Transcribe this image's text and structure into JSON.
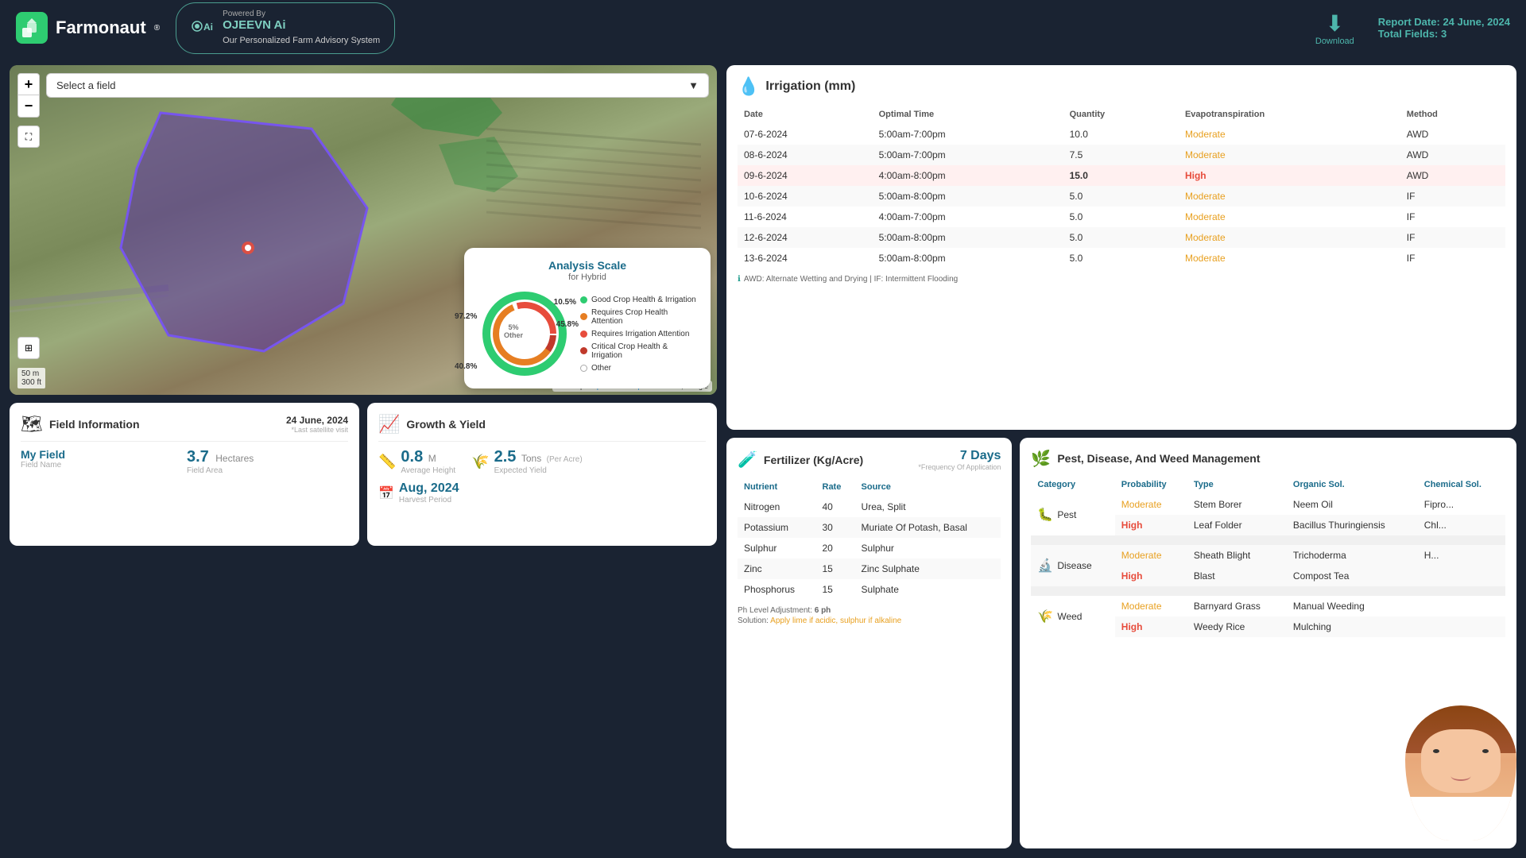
{
  "header": {
    "logo_text": "Farmonaut",
    "logo_reg": "®",
    "jeevn_label": "OJEEVN Ai",
    "jeevn_powered": "Powered By",
    "jeevn_sub": "Our Personalized Farm Advisory System",
    "download_label": "Download",
    "report_date_label": "Report Date:",
    "report_date_value": "24 June, 2024",
    "total_fields_label": "Total Fields:",
    "total_fields_value": "3"
  },
  "map": {
    "field_select_placeholder": "Select a field",
    "zoom_in": "+",
    "zoom_out": "−",
    "scale_m": "50 m",
    "scale_ft": "300 ft",
    "attribution": "Leaflet | © OpenStreetMap contributors, Google"
  },
  "analysis_scale": {
    "title": "Analysis Scale",
    "subtitle": "for Hybrid",
    "pct_97": "97.2%",
    "pct_10": "10.5%",
    "pct_45": "45.8%",
    "pct_5_label": "5%",
    "pct_5_sub": "Other",
    "pct_40": "40.8%",
    "legend": [
      {
        "color": "#2ecc71",
        "label": "Good Crop Health & Irrigation"
      },
      {
        "color": "#e67e22",
        "label": "Requires Crop Health Attention"
      },
      {
        "color": "#e74c3c",
        "label": "Requires Irrigation Attention"
      },
      {
        "color": "#c0392b",
        "label": "Critical Crop Health & Irrigation"
      },
      {
        "color": "#ccc",
        "label": "Other",
        "ring": true
      }
    ]
  },
  "field_info": {
    "section_title": "Field Information",
    "date": "24 June, 2024",
    "last_sat": "*Last satellite visit",
    "field_name_label": "My Field",
    "field_name_sub": "Field Name",
    "area_value": "3.7",
    "area_unit": "Hectares",
    "area_label": "Field Area"
  },
  "growth": {
    "section_title": "Growth & Yield",
    "height_value": "0.8",
    "height_unit": "M",
    "height_label": "Average Height",
    "yield_value": "2.5",
    "yield_unit": "Tons",
    "yield_per": "(Per Acre)",
    "yield_label": "Expected Yield",
    "harvest_month": "Aug, 2024",
    "harvest_label": "Harvest Period"
  },
  "irrigation": {
    "section_title": "Irrigation (mm)",
    "icon": "💧",
    "columns": [
      "Date",
      "Optimal Time",
      "Quantity",
      "Evapotranspiration",
      "Method"
    ],
    "rows": [
      {
        "date": "07-6-2024",
        "time": "5:00am-7:00pm",
        "qty": "10.0",
        "et": "Moderate",
        "method": "AWD",
        "highlight": false
      },
      {
        "date": "08-6-2024",
        "time": "5:00am-7:00pm",
        "qty": "7.5",
        "et": "Moderate",
        "method": "AWD",
        "highlight": false
      },
      {
        "date": "09-6-2024",
        "time": "4:00am-8:00pm",
        "qty": "15.0",
        "et": "High",
        "method": "AWD",
        "highlight": true
      },
      {
        "date": "10-6-2024",
        "time": "5:00am-8:00pm",
        "qty": "5.0",
        "et": "Moderate",
        "method": "IF",
        "highlight": false
      },
      {
        "date": "11-6-2024",
        "time": "4:00am-7:00pm",
        "qty": "5.0",
        "et": "Moderate",
        "method": "IF",
        "highlight": false
      },
      {
        "date": "12-6-2024",
        "time": "5:00am-8:00pm",
        "qty": "5.0",
        "et": "Moderate",
        "method": "IF",
        "highlight": false
      },
      {
        "date": "13-6-2024",
        "time": "5:00am-8:00pm",
        "qty": "5.0",
        "et": "Moderate",
        "method": "IF",
        "highlight": false
      }
    ],
    "note": "AWD: Alternate Wetting and Drying | IF: Intermittent Flooding"
  },
  "fertilizer": {
    "section_title": "Fertilizer (Kg/Acre)",
    "icon": "🧪",
    "freq_days": "7 Days",
    "freq_label": "*Frequency Of Application",
    "columns": [
      "Nutrient",
      "Rate",
      "Source"
    ],
    "rows": [
      {
        "nutrient": "Nitrogen",
        "rate": "40",
        "source": "Urea, Split"
      },
      {
        "nutrient": "Potassium",
        "rate": "30",
        "source": "Muriate Of Potash, Basal"
      },
      {
        "nutrient": "Sulphur",
        "rate": "20",
        "source": "Sulphur"
      },
      {
        "nutrient": "Zinc",
        "rate": "15",
        "source": "Zinc Sulphate"
      },
      {
        "nutrient": "Phosphorus",
        "rate": "15",
        "source": "Sulphate"
      }
    ],
    "ph_label": "Ph Level Adjustment:",
    "ph_value": "6 ph",
    "solution_label": "Solution:",
    "solution_text": "Apply lime if acidic, sulphur if alkaline"
  },
  "pest": {
    "section_title": "Pest, Disease, And Weed Management",
    "icon": "🌿",
    "columns": [
      "Category",
      "Probability",
      "Type",
      "Organic Sol.",
      "Chemical Sol."
    ],
    "categories": [
      {
        "name": "Pest",
        "icon": "🐛",
        "rows": [
          {
            "prob": "Moderate",
            "type": "Stem Borer",
            "organic": "Neem Oil",
            "chemical": "Fipro..."
          },
          {
            "prob": "High",
            "type": "Leaf Folder",
            "organic": "Bacillus Thuringiensis",
            "chemical": "Chl..."
          }
        ]
      },
      {
        "name": "Disease",
        "icon": "🔬",
        "rows": [
          {
            "prob": "Moderate",
            "type": "Sheath Blight",
            "organic": "Trichoderma",
            "chemical": "H..."
          },
          {
            "prob": "High",
            "type": "Blast",
            "organic": "Compost Tea",
            "chemical": ""
          }
        ]
      },
      {
        "name": "Weed",
        "icon": "🌾",
        "rows": [
          {
            "prob": "Moderate",
            "type": "Barnyard Grass",
            "organic": "Manual Weeding",
            "chemical": ""
          },
          {
            "prob": "High",
            "type": "Weedy Rice",
            "organic": "Mulching",
            "chemical": ""
          }
        ]
      }
    ]
  }
}
